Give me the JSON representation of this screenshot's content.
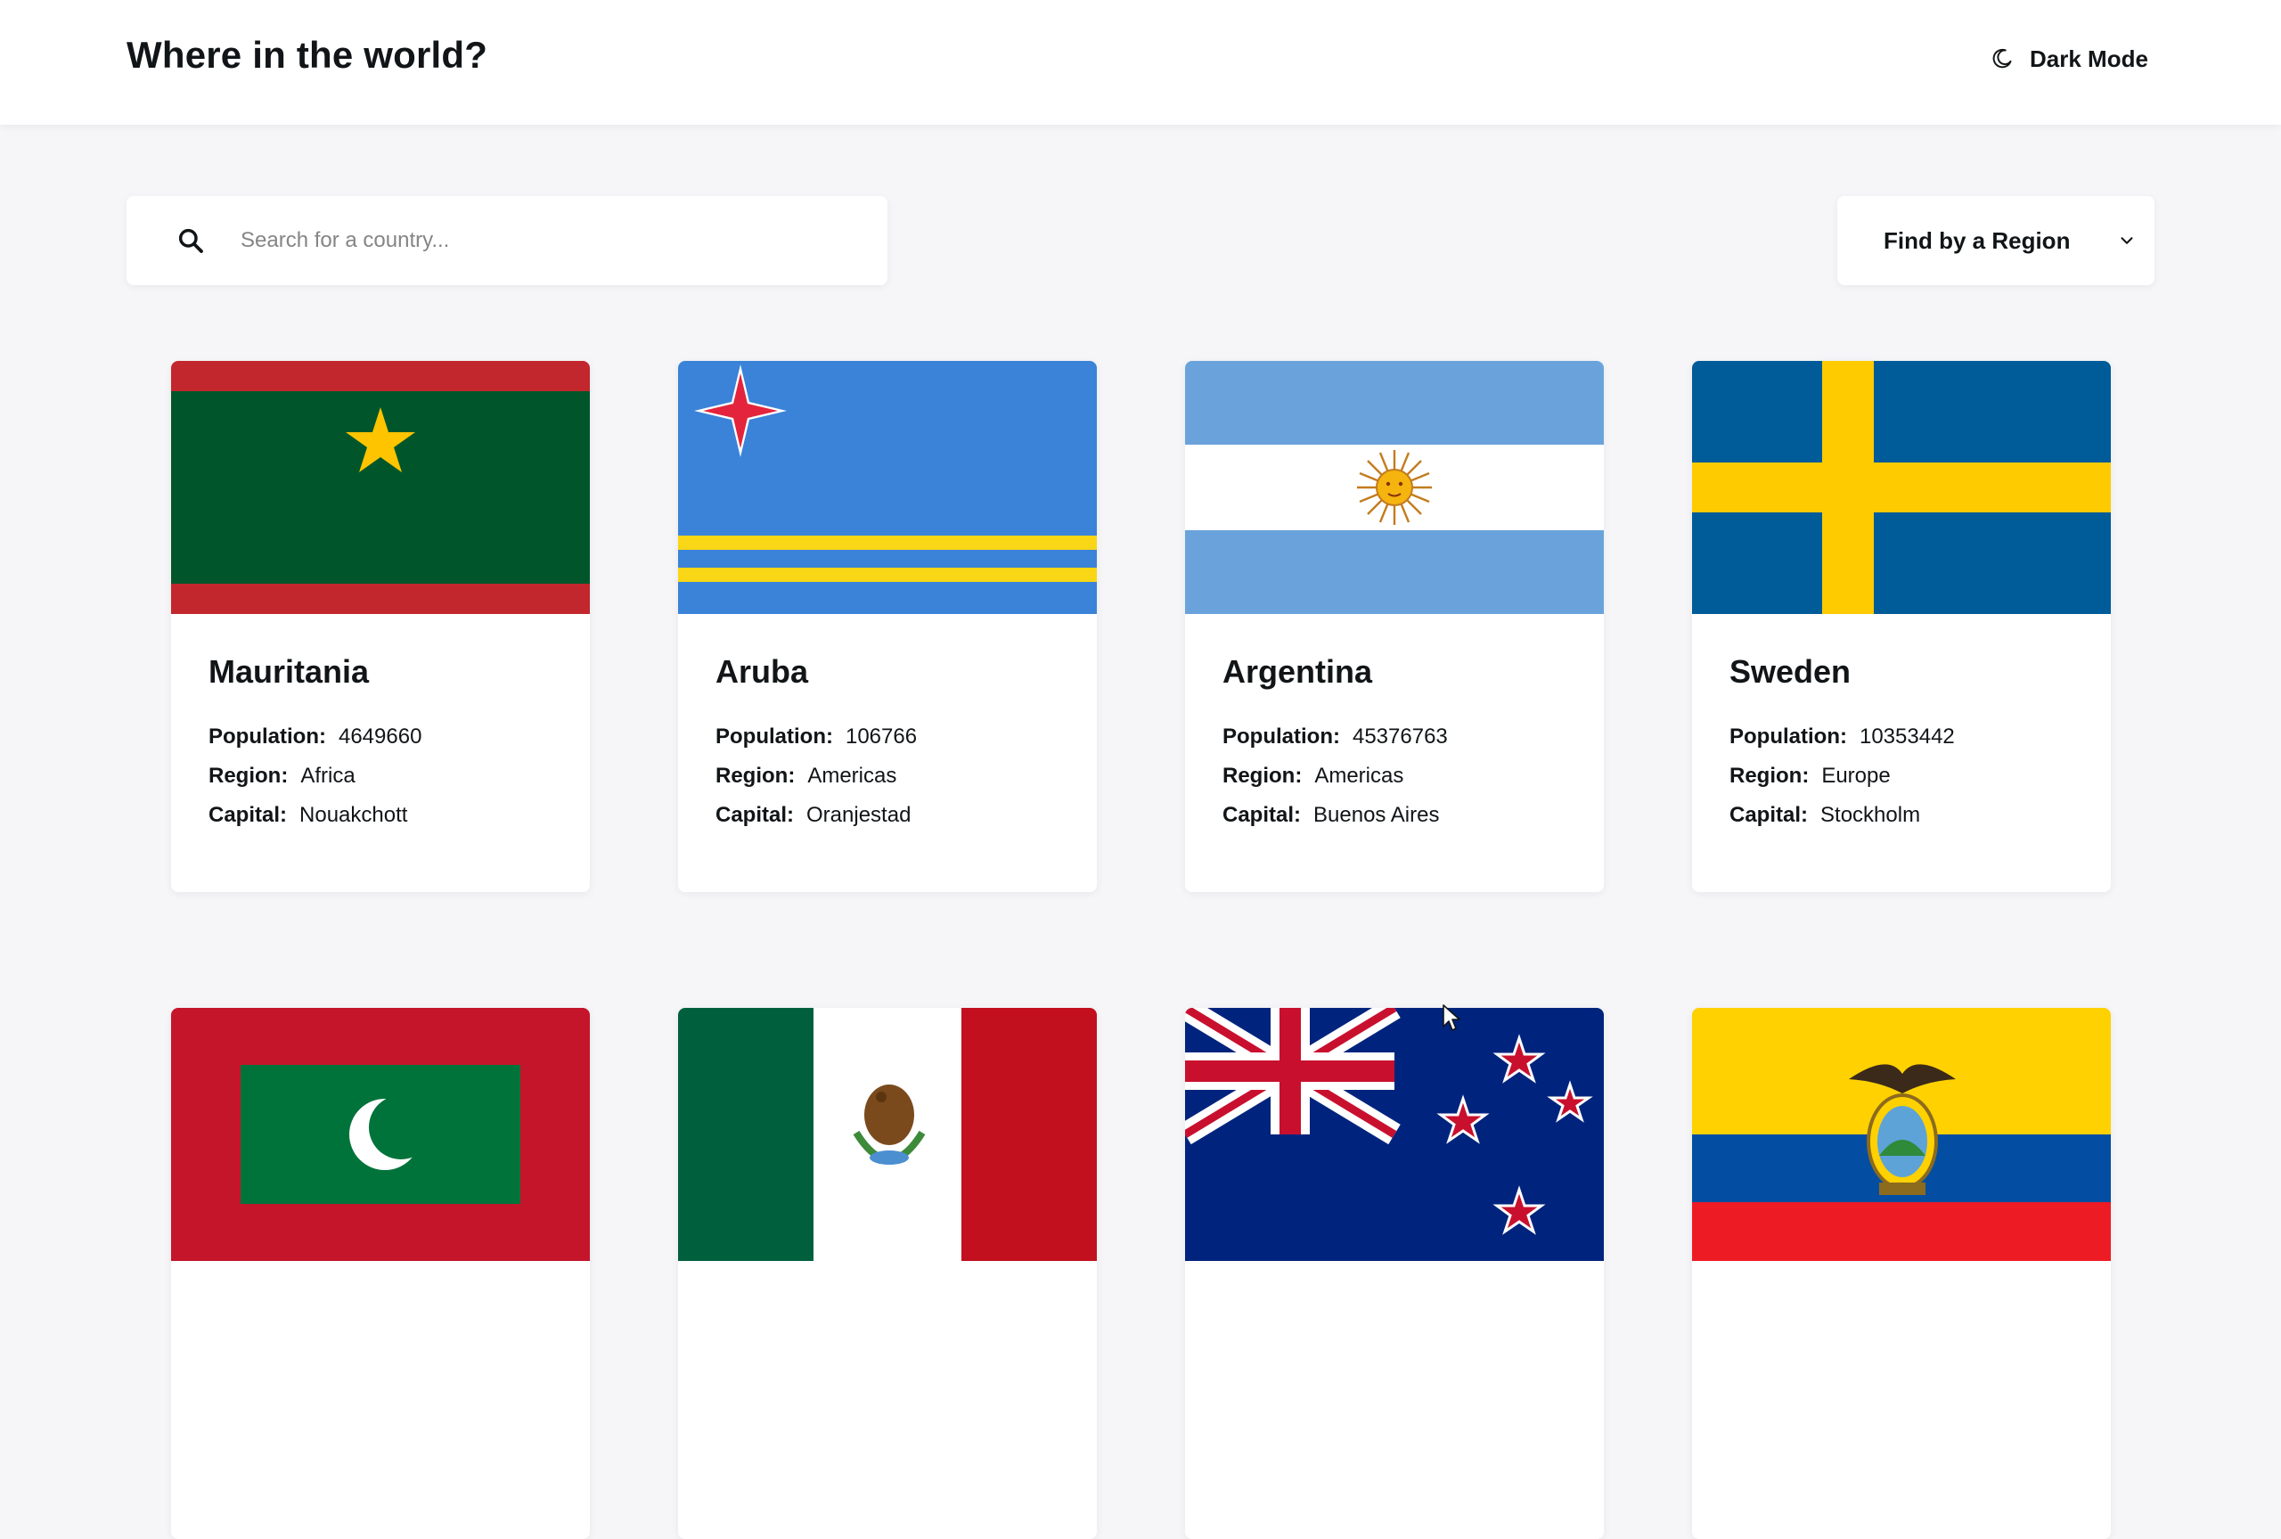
{
  "header": {
    "title": "Where in the world?",
    "dark_mode_label": "Dark Mode",
    "dark_mode_icon": "moon-icon"
  },
  "search": {
    "placeholder": "Search for a country...",
    "value": "",
    "icon": "search-icon"
  },
  "filter": {
    "selected": "Find by a Region",
    "icon": "chevron-down-icon"
  },
  "labels": {
    "population": "Population:",
    "region": "Region:",
    "capital": "Capital:"
  },
  "countries": [
    {
      "name": "Mauritania",
      "population": "4649660",
      "region": "Africa",
      "capital": "Nouakchott",
      "flag": "mauritania-flag"
    },
    {
      "name": "Aruba",
      "population": "106766",
      "region": "Americas",
      "capital": "Oranjestad",
      "flag": "aruba-flag"
    },
    {
      "name": "Argentina",
      "population": "45376763",
      "region": "Americas",
      "capital": "Buenos Aires",
      "flag": "argentina-flag"
    },
    {
      "name": "Sweden",
      "population": "10353442",
      "region": "Europe",
      "capital": "Stockholm",
      "flag": "sweden-flag"
    },
    {
      "name": "",
      "flag": "maldives-flag"
    },
    {
      "name": "",
      "flag": "mexico-flag"
    },
    {
      "name": "",
      "flag": "new-zealand-flag"
    },
    {
      "name": "",
      "flag": "ecuador-flag"
    }
  ],
  "colors": {
    "background": "#f6f6f8",
    "element": "#ffffff",
    "text": "#111517",
    "placeholder": "#858585"
  }
}
